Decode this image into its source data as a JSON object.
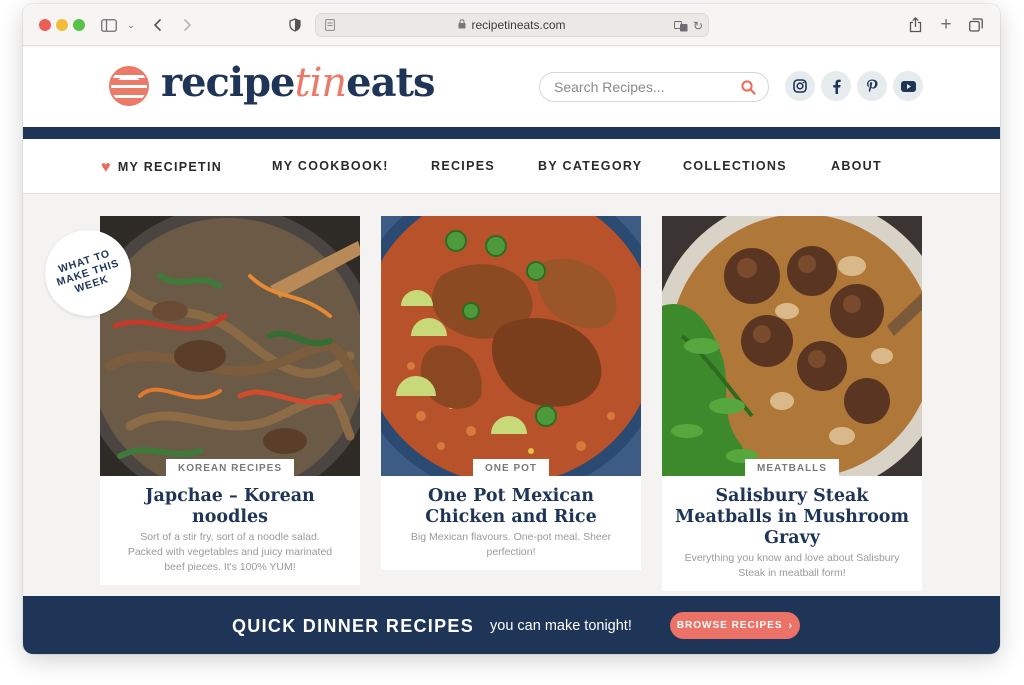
{
  "browser": {
    "url": "recipetineats.com"
  },
  "header": {
    "logo_part1": "recipe",
    "logo_part2": "tin",
    "logo_part3": "eats",
    "search_placeholder": "Search Recipes...",
    "social": [
      "instagram-icon",
      "facebook-icon",
      "pinterest-icon",
      "youtube-icon"
    ]
  },
  "nav": {
    "items": [
      "MY RECIPETIN",
      "MY COOKBOOK!",
      "RECIPES",
      "BY CATEGORY",
      "COLLECTIONS",
      "ABOUT"
    ]
  },
  "badge": {
    "line1": "WHAT TO",
    "line2": "MAKE THIS",
    "line3": "WEEK"
  },
  "cards": [
    {
      "tag": "KOREAN RECIPES",
      "title": "Japchae – Korean noodles",
      "desc": "Sort of a stir fry, sort of a noodle salad. Packed with vegetables and juicy marinated beef pieces. It's 100% YUM!"
    },
    {
      "tag": "ONE POT",
      "title": "One Pot Mexican Chicken and Rice",
      "desc": "Big Mexican flavours. One-pot meal. Sheer perfection!"
    },
    {
      "tag": "MEATBALLS",
      "title": "Salisbury Steak Meatballs in Mushroom Gravy",
      "desc": "Everything you know and love about Salisbury Steak in meatball form!"
    }
  ],
  "banner": {
    "title": "QUICK DINNER RECIPES",
    "subtitle": "you can make tonight!",
    "button": "BROWSE RECIPES"
  },
  "colors": {
    "navy": "#1f3557",
    "coral": "#ec7166",
    "background": "#f4f3f1"
  }
}
